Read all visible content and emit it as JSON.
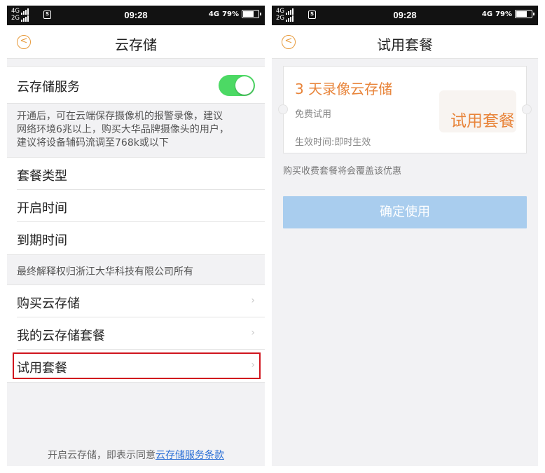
{
  "status_bar": {
    "network_1": "4G",
    "network_2": "2G",
    "time": "09:28",
    "network_right": "4G",
    "battery_text": "79%",
    "battery_level": 0.79
  },
  "left_screen": {
    "title": "云存储",
    "service_toggle": {
      "label": "云存储服务",
      "enabled": true,
      "color": "#4cd964"
    },
    "description": [
      "开通后，可在云端保存摄像机的报警录像，建议",
      "网络环境6兆以上，购买大华品牌摄像头的用户，",
      "建议将设备辅码流调至768k或以下"
    ],
    "info_rows": [
      {
        "label": "套餐类型"
      },
      {
        "label": "开启时间"
      },
      {
        "label": "到期时间"
      }
    ],
    "note": "最终解释权归浙江大华科技有限公司所有",
    "menu_rows": [
      {
        "label": "购买云存储"
      },
      {
        "label": "我的云存储套餐"
      },
      {
        "label": "试用套餐"
      }
    ],
    "footer_text": "开启云存储，即表示同意",
    "footer_link": "云存储服务条款"
  },
  "right_screen": {
    "title": "试用套餐",
    "ticket": {
      "title": "3 天录像云存储",
      "subtitle": "免费试用",
      "effective": "生效时间:即时生效",
      "stamp": "试用套餐"
    },
    "note": "购买收费套餐将会覆盖该优惠",
    "confirm_button": "确定使用"
  },
  "colors": {
    "accent": "#e8843a",
    "button": "#a9cdee",
    "link": "#2a6fd6",
    "highlight": "#d0151e"
  }
}
